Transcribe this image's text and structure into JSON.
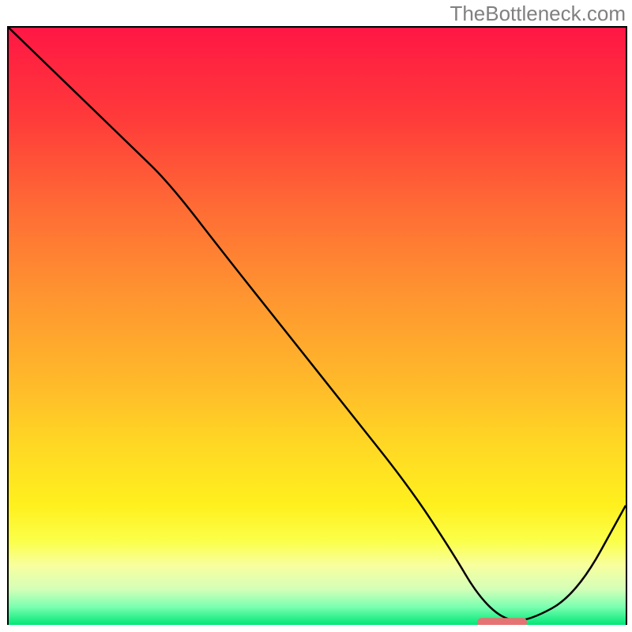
{
  "watermark": "TheBottleneck.com",
  "chart_data": {
    "type": "line",
    "title": "",
    "xlabel": "",
    "ylabel": "",
    "xlim": [
      0,
      100
    ],
    "ylim": [
      0,
      100
    ],
    "background_gradient": {
      "stops": [
        {
          "offset": 0,
          "color": "#ff1744"
        },
        {
          "offset": 15,
          "color": "#ff3a3a"
        },
        {
          "offset": 30,
          "color": "#ff6b35"
        },
        {
          "offset": 45,
          "color": "#ff9530"
        },
        {
          "offset": 60,
          "color": "#ffbb2a"
        },
        {
          "offset": 70,
          "color": "#ffd824"
        },
        {
          "offset": 80,
          "color": "#fff01e"
        },
        {
          "offset": 86,
          "color": "#fbff4a"
        },
        {
          "offset": 90,
          "color": "#f8ff9e"
        },
        {
          "offset": 94,
          "color": "#d4ffb8"
        },
        {
          "offset": 97,
          "color": "#7affb0"
        },
        {
          "offset": 100,
          "color": "#00e676"
        }
      ]
    },
    "series": [
      {
        "name": "curve",
        "x": [
          0,
          10,
          20,
          26,
          35,
          45,
          55,
          65,
          72,
          76,
          80,
          84,
          92,
          100
        ],
        "y": [
          100,
          90,
          80,
          74,
          62,
          49,
          36,
          23,
          12,
          5,
          1,
          0.5,
          5,
          20
        ]
      }
    ],
    "flat_segment": {
      "x_start": 76,
      "x_end": 84,
      "y": 0.5,
      "color": "#e57373"
    }
  }
}
